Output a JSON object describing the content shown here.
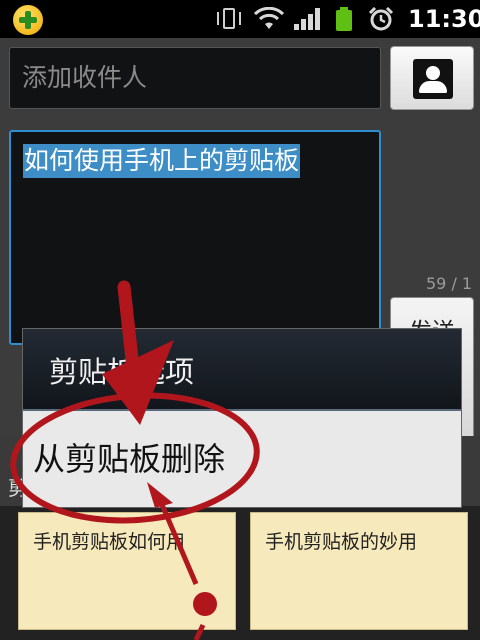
{
  "status_bar": {
    "time": "11:30"
  },
  "compose": {
    "recipient_placeholder": "添加收件人",
    "message_selected_text": "如何使用手机上的剪贴板",
    "counter": "59 / 1",
    "send_label": "发送"
  },
  "context_menu": {
    "title": "剪贴板选项",
    "item_delete": "从剪贴板删除"
  },
  "bottom": {
    "strip_label": "剪",
    "notes": [
      "手机剪贴板如何用",
      "手机剪贴板的妙用"
    ]
  },
  "annotation_color": "#b0161c"
}
